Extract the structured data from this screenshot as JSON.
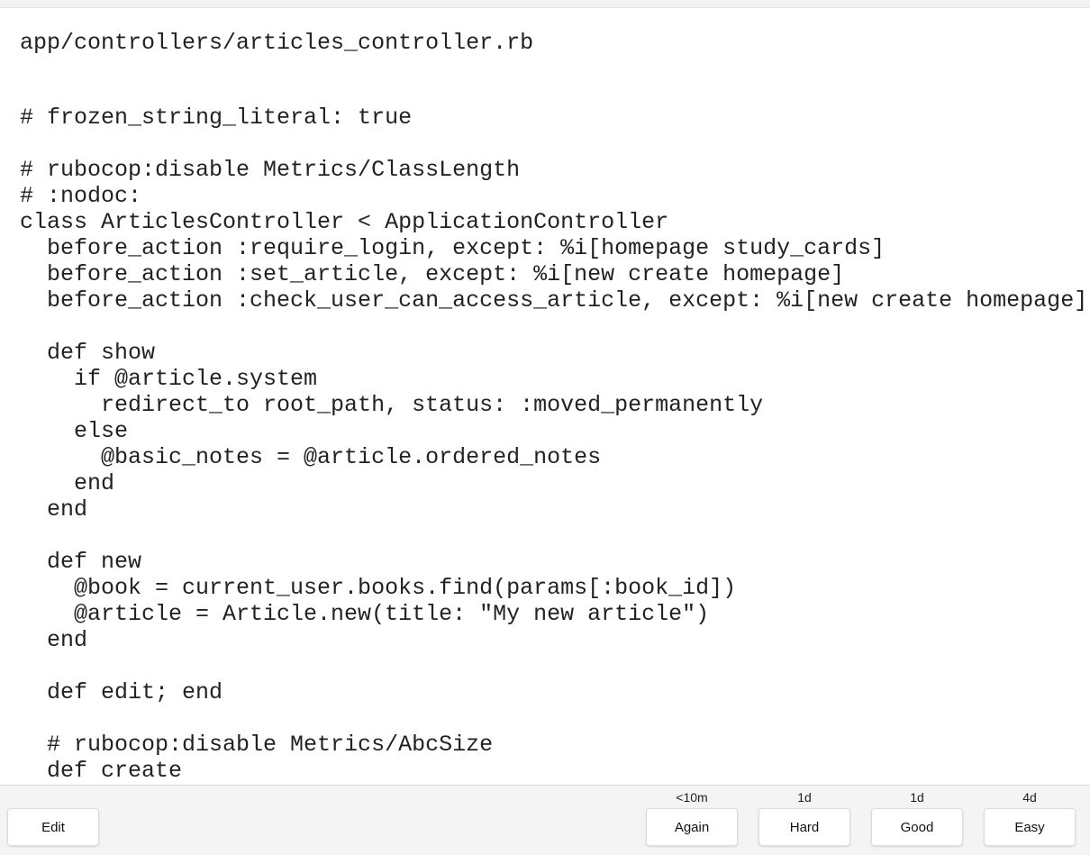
{
  "card": {
    "file_path": "app/controllers/articles_controller.rb",
    "code_lines": [
      "# frozen_string_literal: true",
      "",
      "# rubocop:disable Metrics/ClassLength",
      "# :nodoc:",
      "class ArticlesController < ApplicationController",
      "  before_action :require_login, except: %i[homepage study_cards]",
      "  before_action :set_article, except: %i[new create homepage]",
      "  before_action :check_user_can_access_article, except: %i[new create homepage]",
      "",
      "  def show",
      "    if @article.system",
      "      redirect_to root_path, status: :moved_permanently",
      "    else",
      "      @basic_notes = @article.ordered_notes",
      "    end",
      "  end",
      "",
      "  def new",
      "    @book = current_user.books.find(params[:book_id])",
      "    @article = Article.new(title: \"My new article\")",
      "  end",
      "",
      "  def edit; end",
      "",
      "  # rubocop:disable Metrics/AbcSize",
      "  def create"
    ]
  },
  "bottom_bar": {
    "edit_label": "Edit",
    "answers": [
      {
        "label": "Again",
        "interval": "<10m"
      },
      {
        "label": "Hard",
        "interval": "1d"
      },
      {
        "label": "Good",
        "interval": "1d"
      },
      {
        "label": "Easy",
        "interval": "4d"
      }
    ]
  }
}
